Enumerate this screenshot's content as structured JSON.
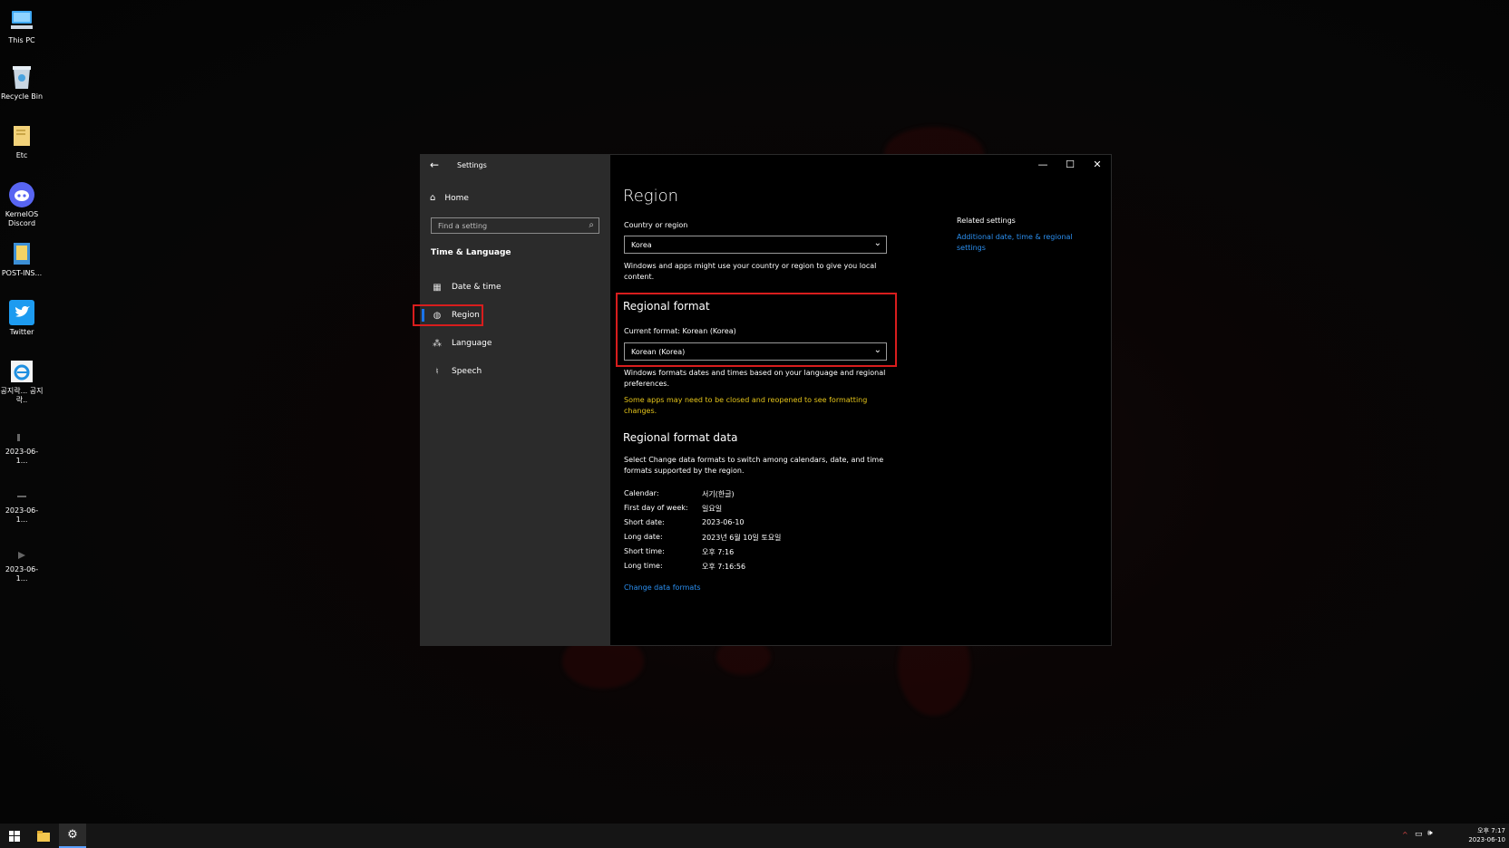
{
  "desktop": {
    "icons": [
      {
        "label": "This PC",
        "icon": "computer-icon"
      },
      {
        "label": "Recycle Bin",
        "icon": "recycle-bin-icon"
      },
      {
        "label": "Etc",
        "icon": "folder-icon"
      },
      {
        "label": "KernelOS Discord",
        "icon": "discord-icon"
      },
      {
        "label": "POST-INS...",
        "icon": "folder-icon"
      },
      {
        "label": "Twitter",
        "icon": "twitter-icon"
      },
      {
        "label": "공지락... 공지락..",
        "icon": "internet-explorer-icon"
      },
      {
        "label": "2023-06-1...",
        "icon": "file-icon"
      },
      {
        "label": "2023-06-1...",
        "icon": "file-icon"
      },
      {
        "label": "2023-06-1...",
        "icon": "file-icon"
      }
    ]
  },
  "window": {
    "title": "Settings",
    "sidebar": {
      "home_label": "Home",
      "search_placeholder": "Find a setting",
      "group_title": "Time & Language",
      "items": [
        {
          "label": "Date & time",
          "icon": "calendar-clock-icon"
        },
        {
          "label": "Region",
          "icon": "globe-icon",
          "active": true
        },
        {
          "label": "Language",
          "icon": "language-icon"
        },
        {
          "label": "Speech",
          "icon": "microphone-icon"
        }
      ]
    },
    "main": {
      "page_title": "Region",
      "country_label": "Country or region",
      "country_value": "Korea",
      "country_note": "Windows and apps might use your country or region to give you local content.",
      "regional_format_heading": "Regional format",
      "current_format": "Current format: Korean (Korea)",
      "format_value": "Korean (Korea)",
      "format_note": "Windows formats dates and times based on your language and regional preferences.",
      "format_warning": "Some apps may need to be closed and reopened to see formatting changes.",
      "data_heading": "Regional format data",
      "data_note": "Select Change data formats to switch among calendars, date, and time formats supported by the region.",
      "rows": [
        {
          "key": "Calendar:",
          "value": "서기(한글)"
        },
        {
          "key": "First day of week:",
          "value": "일요일"
        },
        {
          "key": "Short date:",
          "value": "2023-06-10"
        },
        {
          "key": "Long date:",
          "value": "2023년 6월 10일 토요일"
        },
        {
          "key": "Short time:",
          "value": "오후 7:16"
        },
        {
          "key": "Long time:",
          "value": "오후 7:16:56"
        }
      ],
      "change_link": "Change data formats",
      "related_title": "Related settings",
      "related_link": "Additional date, time & regional settings"
    },
    "controls": {
      "minimize": "—",
      "maximize": "☐",
      "close": "✕"
    }
  },
  "taskbar": {
    "clock_time": "오후 7:17",
    "clock_date": "2023-06-10"
  },
  "colors": {
    "accent": "#1a73e8",
    "link": "#2b8ff0",
    "warning": "#e3c31a",
    "highlight": "#d81d1d"
  }
}
